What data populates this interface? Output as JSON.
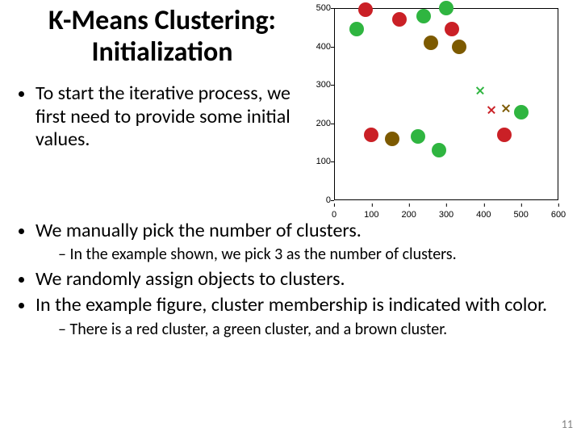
{
  "title": "K-Means Clustering: Initialization",
  "bullets": {
    "b1": "To start the iterative process, we first need to provide some initial values.",
    "b2": "We manually pick the number of clusters.",
    "b2s1": "In the example shown, we pick 3 as the number of clusters.",
    "b3": "We randomly assign objects to clusters.",
    "b4": "In the example figure, cluster membership is indicated with color.",
    "b4s1": "There is a red cluster, a green cluster, and a brown cluster."
  },
  "page_number": "11",
  "chart_data": {
    "type": "scatter",
    "title": "",
    "xlabel": "",
    "ylabel": "",
    "xlim": [
      0,
      600
    ],
    "ylim": [
      0,
      500
    ],
    "xticks": [
      0,
      100,
      200,
      300,
      400,
      500,
      600
    ],
    "yticks": [
      0,
      100,
      200,
      300,
      400,
      500
    ],
    "colors": {
      "red": "#ca2026",
      "green": "#2fb540",
      "brown": "#7d5a00"
    },
    "series": [
      {
        "name": "red-points",
        "marker": "circle",
        "color_key": "red",
        "points": [
          {
            "x": 85,
            "y": 495
          },
          {
            "x": 175,
            "y": 470
          },
          {
            "x": 315,
            "y": 445
          },
          {
            "x": 100,
            "y": 170
          },
          {
            "x": 455,
            "y": 170
          }
        ]
      },
      {
        "name": "green-points",
        "marker": "circle",
        "color_key": "green",
        "points": [
          {
            "x": 60,
            "y": 445
          },
          {
            "x": 240,
            "y": 480
          },
          {
            "x": 300,
            "y": 500
          },
          {
            "x": 225,
            "y": 165
          },
          {
            "x": 280,
            "y": 130
          },
          {
            "x": 500,
            "y": 230
          }
        ]
      },
      {
        "name": "brown-points",
        "marker": "circle",
        "color_key": "brown",
        "points": [
          {
            "x": 260,
            "y": 410
          },
          {
            "x": 335,
            "y": 400
          },
          {
            "x": 155,
            "y": 160
          }
        ]
      },
      {
        "name": "green-center",
        "marker": "cross",
        "color_key": "green",
        "points": [
          {
            "x": 390,
            "y": 285
          }
        ]
      },
      {
        "name": "red-center",
        "marker": "cross",
        "color_key": "red",
        "points": [
          {
            "x": 420,
            "y": 235
          }
        ]
      },
      {
        "name": "brown-center",
        "marker": "cross",
        "color_key": "brown",
        "points": [
          {
            "x": 460,
            "y": 240
          }
        ]
      }
    ]
  }
}
